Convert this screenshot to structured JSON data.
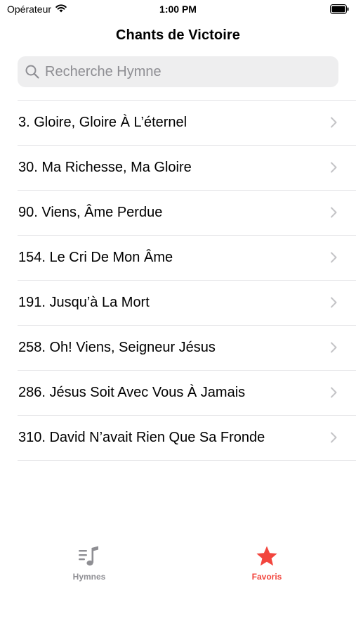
{
  "status_bar": {
    "carrier": "Opérateur",
    "time": "1:00 PM"
  },
  "nav": {
    "title": "Chants de Victoire"
  },
  "search": {
    "placeholder": "Recherche Hymne",
    "value": ""
  },
  "hymns": [
    {
      "label": "3. Gloire, Gloire À L’éternel"
    },
    {
      "label": "30. Ma Richesse, Ma Gloire"
    },
    {
      "label": "90. Viens, Âme Perdue"
    },
    {
      "label": "154. Le Cri De Mon Âme"
    },
    {
      "label": "191. Jusqu’à La Mort"
    },
    {
      "label": "258. Oh! Viens, Seigneur Jésus"
    },
    {
      "label": "286. Jésus Soit Avec Vous À Jamais"
    },
    {
      "label": "310. David N’avait Rien Que Sa Fronde"
    }
  ],
  "tab_bar": {
    "tabs": [
      {
        "label": "Hymnes",
        "icon": "music-list-icon",
        "selected": false
      },
      {
        "label": "Favoris",
        "icon": "star-icon",
        "selected": true
      }
    ]
  },
  "colors": {
    "accent": "#f2453d",
    "inactive_tab": "#8e8e93",
    "chevron": "#c4c4c7",
    "separator": "#e3e3e6",
    "search_bg": "#eeeeef"
  }
}
